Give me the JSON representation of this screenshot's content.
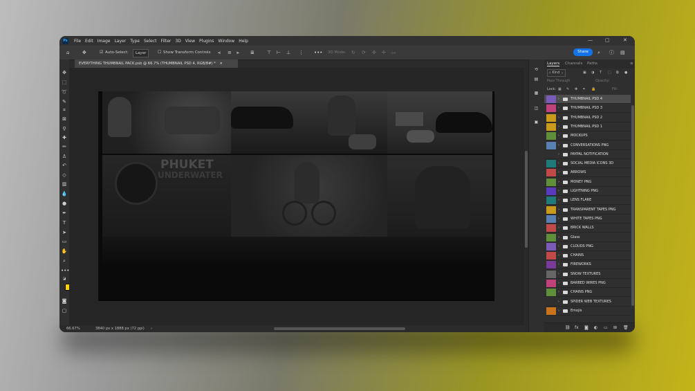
{
  "app": {
    "logo": "Ps",
    "menu": [
      "File",
      "Edit",
      "Image",
      "Layer",
      "Type",
      "Select",
      "Filter",
      "3D",
      "View",
      "Plugins",
      "Window",
      "Help"
    ],
    "window_controls": [
      "—",
      "▢",
      "✕"
    ]
  },
  "options_bar": {
    "auto_select_label": "Auto-Select:",
    "auto_select_value": "Layer",
    "transform_label": "Show Transform Controls",
    "mode_label": "3D Mode:",
    "share_label": "Share"
  },
  "document": {
    "tab_title": "EVERYTHING THUMBNAIL PACK.psb @ 66.7% (THUMBNAIL PSD 4, RGB/8#) *",
    "canvas_text_1": "PHUKET",
    "canvas_text_2": "UNDERWATER"
  },
  "status_bar": {
    "zoom": "66.67%",
    "info": "3840 px x 1888 px (72 ppi)"
  },
  "panel": {
    "tabs": [
      "Layers",
      "Channels",
      "Paths"
    ],
    "active_tab": "Layers",
    "filter_kind": "Kind",
    "blend_mode": "Pass Through",
    "opacity_label": "Opacity:",
    "lock_label": "Lock:",
    "fill_label": "Fill:"
  },
  "layers": [
    {
      "name": "THUMBNAIL PSD 4",
      "color": "#7a5cb8",
      "selected": true
    },
    {
      "name": "THUMBNAIL PSD 3",
      "color": "#c0427a",
      "selected": false
    },
    {
      "name": "THUMBNAIL PSD 2",
      "color": "#c99a1c",
      "selected": false
    },
    {
      "name": "THUMBNAIL PSD 1",
      "color": "#c99a1c",
      "selected": false
    },
    {
      "name": "MOCKUPS",
      "color": "#5f8f3a",
      "selected": false
    },
    {
      "name": "CONVERSATIONS PNG",
      "color": "#5a7fb3",
      "selected": false
    },
    {
      "name": "PAYPAL NOTIFICATION",
      "color": "#2f2f2f",
      "selected": false
    },
    {
      "name": "SOCIAL MEDIA ICONS 3D",
      "color": "#1f7a7a",
      "selected": false
    },
    {
      "name": "ARROWS",
      "color": "#c04a4a",
      "selected": false
    },
    {
      "name": "MONEY PNG",
      "color": "#5f8f3a",
      "selected": false
    },
    {
      "name": "LIGHTNING PNG",
      "color": "#5a3bbf",
      "selected": false
    },
    {
      "name": "LENS FLARE",
      "color": "#1f7a7a",
      "selected": false
    },
    {
      "name": "TRANSPARENT TAPES PNG",
      "color": "#c99a1c",
      "selected": false
    },
    {
      "name": "WHITE TAPES PNG",
      "color": "#5a7fb3",
      "selected": false
    },
    {
      "name": "BRICK WALLS",
      "color": "#c04a4a",
      "selected": false
    },
    {
      "name": "Glass",
      "color": "#5f8f3a",
      "selected": false
    },
    {
      "name": "CLOUDS PNG",
      "color": "#7a5cb8",
      "selected": false
    },
    {
      "name": "CHAINS",
      "color": "#c04a4a",
      "selected": false
    },
    {
      "name": "FIREWORKS",
      "color": "#7a3a9a",
      "selected": false
    },
    {
      "name": "SNOW TEXTURES",
      "color": "#666666",
      "selected": false
    },
    {
      "name": "BARBED WIRES PNG",
      "color": "#c0427a",
      "selected": false
    },
    {
      "name": "CHAINS PNG",
      "color": "#5f8f3a",
      "selected": false
    },
    {
      "name": "SPIDER WEB TEXTURES",
      "color": "#2f2f2f",
      "selected": false
    },
    {
      "name": "Emojis",
      "color": "#c9741c",
      "selected": false
    }
  ],
  "colors": {
    "foreground": "#ffd400",
    "background": "#ff8000",
    "accent": "#1473e6"
  }
}
